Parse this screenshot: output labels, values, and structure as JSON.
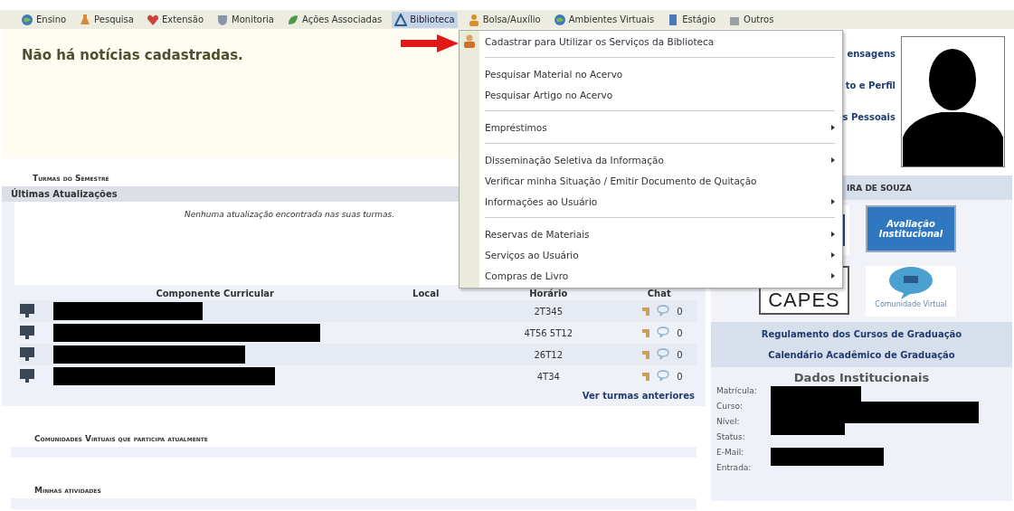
{
  "menubar": [
    {
      "label": "Ensino",
      "selected": false,
      "kind": "globe"
    },
    {
      "label": "Pesquisa",
      "selected": false,
      "kind": "flask"
    },
    {
      "label": "Extensão",
      "selected": false,
      "kind": "heart"
    },
    {
      "label": "Monitoria",
      "selected": false,
      "kind": "shield"
    },
    {
      "label": "Ações Associadas",
      "selected": false,
      "kind": "leaf"
    },
    {
      "label": "Biblioteca",
      "selected": true,
      "kind": "book"
    },
    {
      "label": "Bolsa/Auxílio",
      "selected": false,
      "kind": "person"
    },
    {
      "label": "Ambientes Virtuais",
      "selected": false,
      "kind": "globe"
    },
    {
      "label": "Estágio",
      "selected": false,
      "kind": "doc"
    },
    {
      "label": "Outros",
      "selected": false,
      "kind": "box"
    }
  ],
  "dropdown": {
    "groups": [
      [
        {
          "label": "Cadastrar para Utilizar os Serviços da Biblioteca",
          "submenu": false,
          "kind": "person"
        }
      ],
      [
        {
          "label": "Pesquisar Material no Acervo",
          "submenu": false
        },
        {
          "label": "Pesquisar Artigo no Acervo",
          "submenu": false
        }
      ],
      [
        {
          "label": "Empréstimos",
          "submenu": true
        }
      ],
      [
        {
          "label": "Disseminação Seletiva da Informação",
          "submenu": true
        },
        {
          "label": "Verificar minha Situação / Emitir Documento de Quitação",
          "submenu": false
        },
        {
          "label": "Informações ao Usuário",
          "submenu": true
        }
      ],
      [
        {
          "label": "Reservas de Materiais",
          "submenu": true
        },
        {
          "label": "Serviços ao Usuário",
          "submenu": true
        },
        {
          "label": "Compras de Livro",
          "submenu": true
        }
      ]
    ]
  },
  "news": {
    "message": "Não há notícias cadastradas."
  },
  "turmas": {
    "title": "Turmas do Semestre",
    "updates_header": "Últimas Atualizações",
    "updates_message": "Nenhuma atualização encontrada nas suas turmas.",
    "columns": [
      "Componente Curricular",
      "Local",
      "Horário",
      "Chat"
    ],
    "rows": [
      {
        "horario": "2T345",
        "chat": "0"
      },
      {
        "horario": "4T56 5T12",
        "chat": "0"
      },
      {
        "horario": "26T12",
        "chat": "0"
      },
      {
        "horario": "4T34",
        "chat": "0"
      }
    ],
    "more_link": "Ver turmas anteriores"
  },
  "sections": [
    "Comunidades Virtuais que participa atualmente",
    "Minhas atividades"
  ],
  "profile": {
    "links": [
      "ensagens",
      "to e Perfil",
      "s Pessoais"
    ],
    "name": "IRA DE SOUZA"
  },
  "logos": {
    "avaliacao": "Avaliação Institucional",
    "capes": "CAPES",
    "comunidade": "Comunidade Virtual"
  },
  "info_links": [
    "Regulamento dos Cursos de Graduação",
    "Calendário Acadêmico de Graduação"
  ],
  "dados": {
    "title": "Dados Institucionais",
    "fields": [
      "Matrícula:",
      "Curso:",
      "Nível:",
      "Status:",
      "E-Mail:",
      "Entrada:"
    ]
  }
}
